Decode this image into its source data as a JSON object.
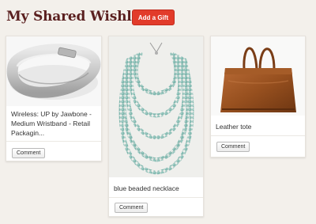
{
  "header": {
    "title": "My Shared Wishlist",
    "add_button_label": "Add a Gift"
  },
  "colors": {
    "title": "#5a1f1f",
    "accent_button": "#e23b2a",
    "background": "#f3f0eb"
  },
  "items": [
    {
      "title": "Wireless: UP by Jawbone - Medium Wristband - Retail Packagin...",
      "image_icon": "wristband-icon",
      "comment_label": "Comment"
    },
    {
      "title": "blue beaded necklace",
      "image_icon": "necklace-icon",
      "comment_label": "Comment"
    },
    {
      "title": "Leather tote",
      "image_icon": "tote-bag-icon",
      "comment_label": "Comment"
    }
  ]
}
